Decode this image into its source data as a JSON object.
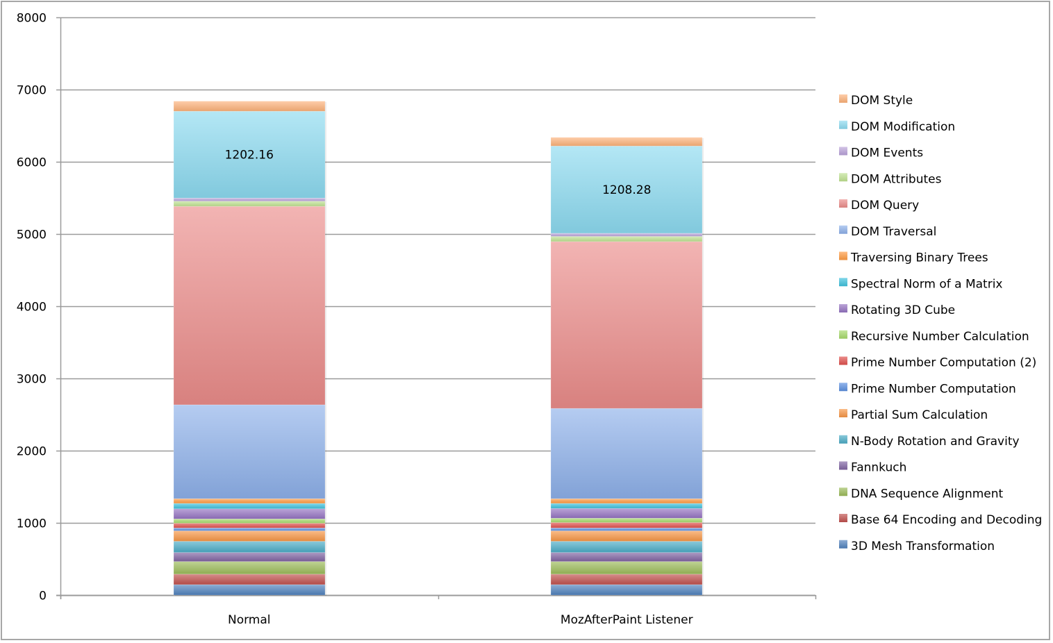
{
  "chart_data": {
    "type": "bar",
    "stacked": true,
    "title": "",
    "xlabel": "",
    "ylabel": "",
    "ylim": [
      0,
      8000
    ],
    "yticks": [
      0,
      1000,
      2000,
      3000,
      4000,
      5000,
      6000,
      7000,
      8000
    ],
    "grid": true,
    "legend_position": "right",
    "categories": [
      "Normal",
      "MozAfterPaint Listener"
    ],
    "series": [
      {
        "name": "3D Mesh Transformation",
        "color": "#4f81bd",
        "values": [
          145,
          145
        ]
      },
      {
        "name": "Base 64 Encoding and Decoding",
        "color": "#c0504d",
        "values": [
          145,
          145
        ]
      },
      {
        "name": "DNA Sequence Alignment",
        "color": "#9bbb59",
        "values": [
          175,
          175
        ]
      },
      {
        "name": "Fannkuch",
        "color": "#8064a2",
        "values": [
          125,
          125
        ]
      },
      {
        "name": "N-Body Rotation and Gravity",
        "color": "#4bacc6",
        "values": [
          155,
          155
        ]
      },
      {
        "name": "Partial Sum Calculation",
        "color": "#f79646",
        "values": [
          145,
          145
        ]
      },
      {
        "name": "Prime Number Computation",
        "color": "#5b8fe0",
        "values": [
          40,
          40
        ]
      },
      {
        "name": "Prime Number Computation (2)",
        "color": "#e0504d",
        "values": [
          65,
          75
        ]
      },
      {
        "name": "Recursive Number Calculation",
        "color": "#a6d96a",
        "values": [
          60,
          60
        ]
      },
      {
        "name": "Rotating 3D Cube",
        "color": "#9573c2",
        "values": [
          140,
          135
        ]
      },
      {
        "name": "Spectral Norm of a Matrix",
        "color": "#3fc1dd",
        "values": [
          75,
          70
        ]
      },
      {
        "name": "Traversing Binary Trees",
        "color": "#ff9a40",
        "values": [
          65,
          65
        ]
      },
      {
        "name": "DOM Traversal",
        "color": "#8db0ea",
        "values": [
          1300,
          1250
        ]
      },
      {
        "name": "DOM Query",
        "color": "#eb8c8a",
        "values": [
          2748,
          2310
        ]
      },
      {
        "name": "DOM Attributes",
        "color": "#bfe291",
        "values": [
          72,
          72
        ]
      },
      {
        "name": "DOM Events",
        "color": "#b9a2d9",
        "values": [
          43,
          43
        ]
      },
      {
        "name": "DOM Modification",
        "color": "#8cdaf0",
        "values": [
          1202.16,
          1208.28
        ]
      },
      {
        "name": "DOM Style",
        "color": "#fdb27a",
        "values": [
          140,
          120
        ]
      }
    ],
    "data_labels": [
      {
        "series": "DOM Modification",
        "category": "Normal",
        "text": "1202.16"
      },
      {
        "series": "DOM Modification",
        "category": "MozAfterPaint Listener",
        "text": "1208.28"
      }
    ]
  }
}
